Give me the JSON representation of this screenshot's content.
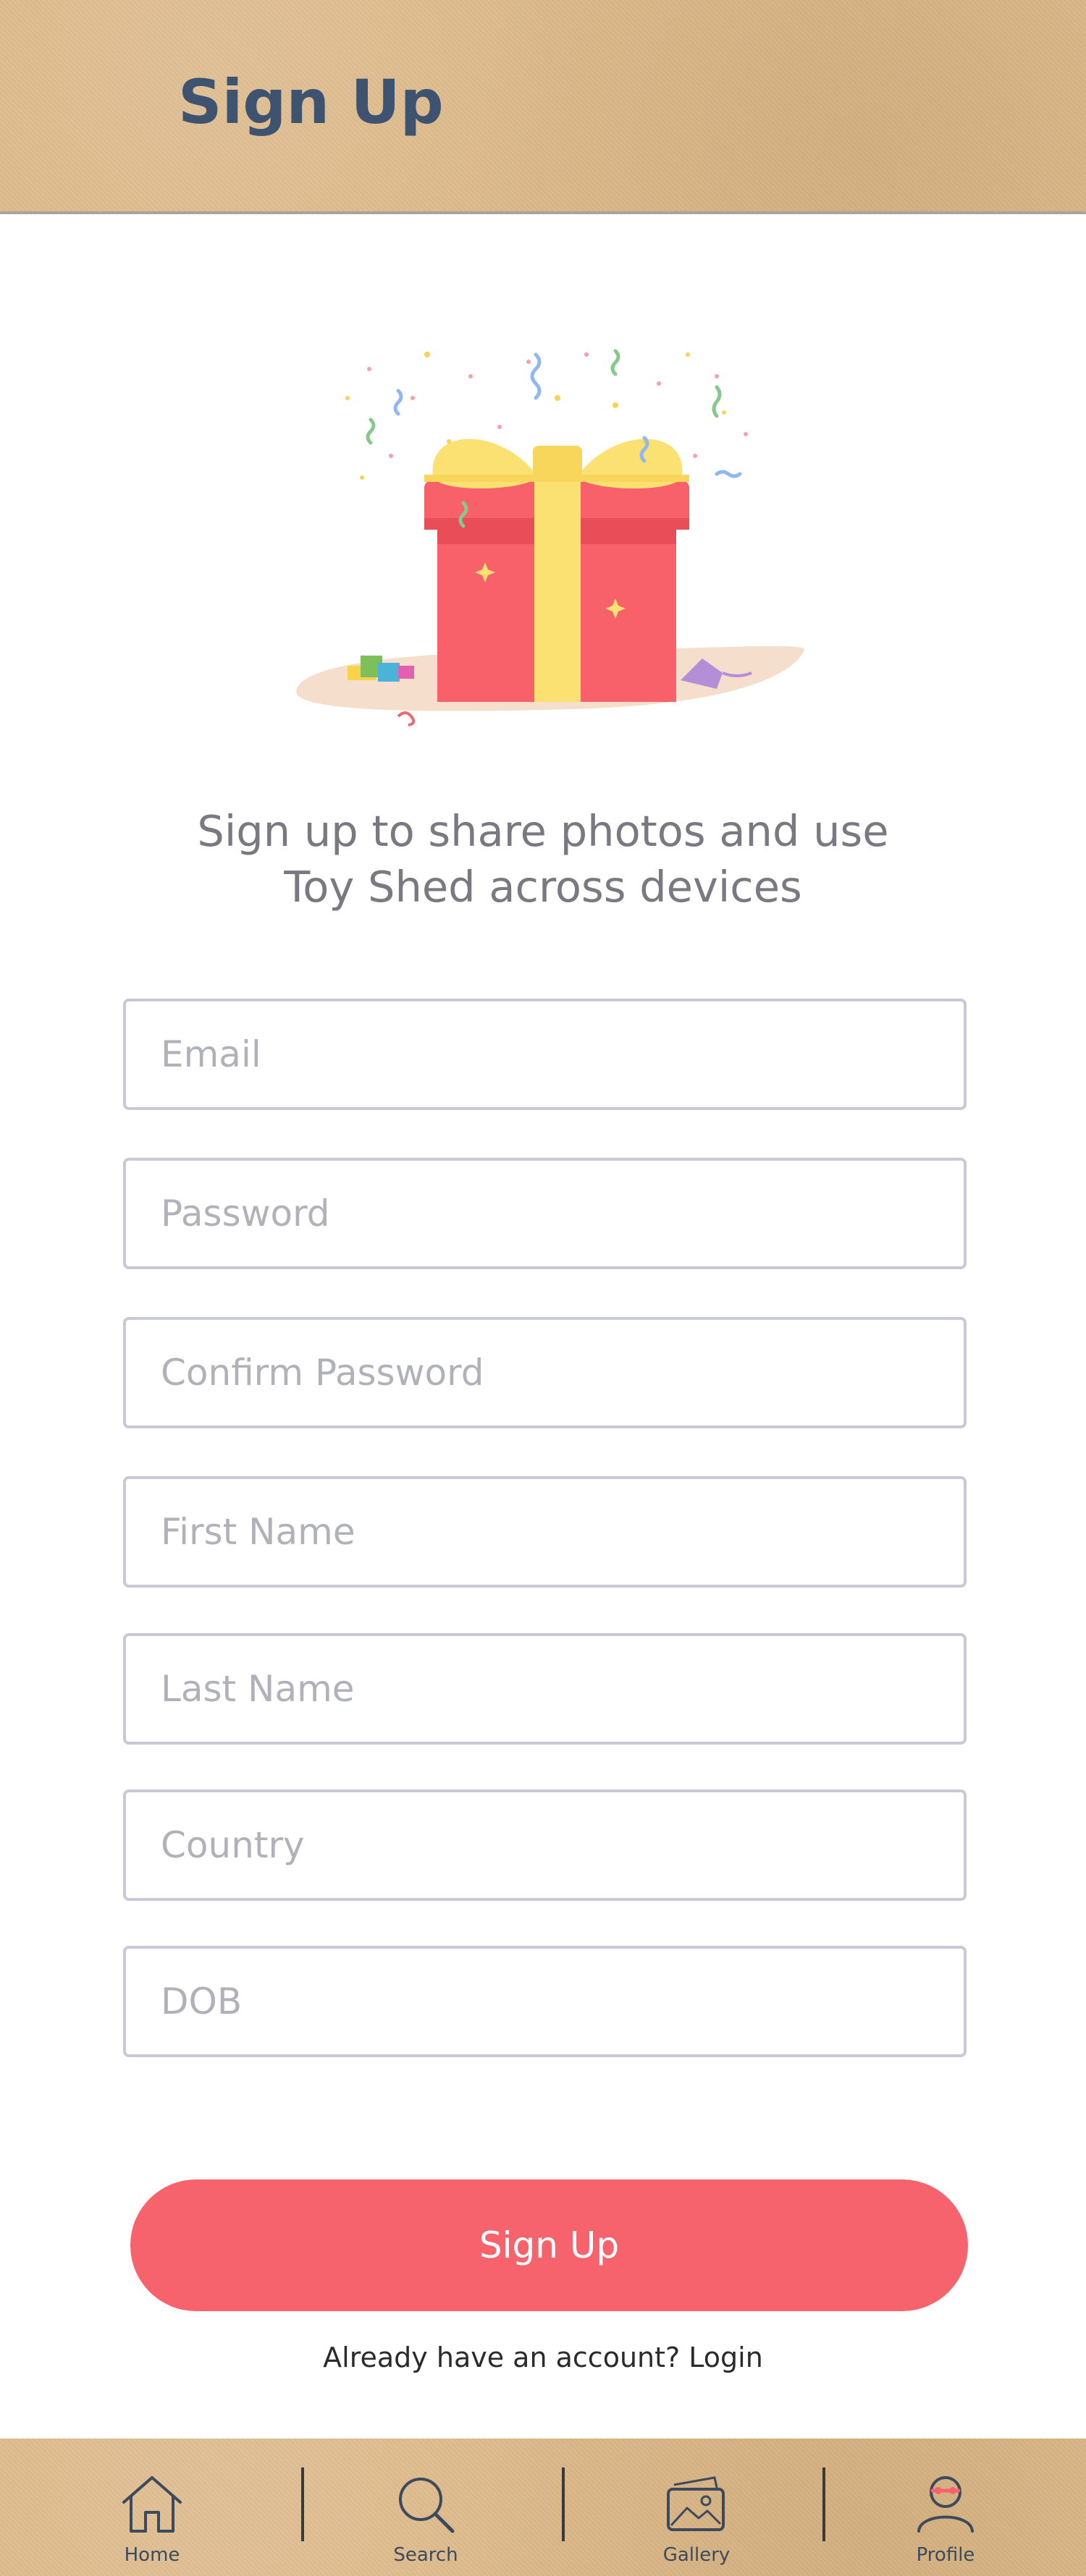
{
  "header": {
    "title": "Sign Up"
  },
  "hero": {
    "illustration": "gift-box-with-confetti"
  },
  "tagline": {
    "line1": "Sign up to share photos and use",
    "line2": "Toy Shed across devices"
  },
  "form": {
    "email_placeholder": "Email",
    "password_placeholder": "Password",
    "confirm_password_placeholder": "Confirm Password",
    "first_name_placeholder": "First Name",
    "last_name_placeholder": "Last Name",
    "country_placeholder": "Country",
    "dob_placeholder": "DOB"
  },
  "actions": {
    "signup_label": "Sign Up",
    "login_prompt": "Already have an account?",
    "login_link": "Login"
  },
  "tabbar": {
    "items": [
      {
        "label": "Home",
        "icon": "home-icon"
      },
      {
        "label": "Search",
        "icon": "search-icon"
      },
      {
        "label": "Gallery",
        "icon": "gallery-icon"
      },
      {
        "label": "Profile",
        "icon": "profile-icon"
      }
    ]
  },
  "colors": {
    "accent": "#f7636d",
    "title": "#3d5370",
    "kraft": "#dcb98a",
    "input_border": "#c9c8d6",
    "placeholder": "#b1b1b9"
  }
}
